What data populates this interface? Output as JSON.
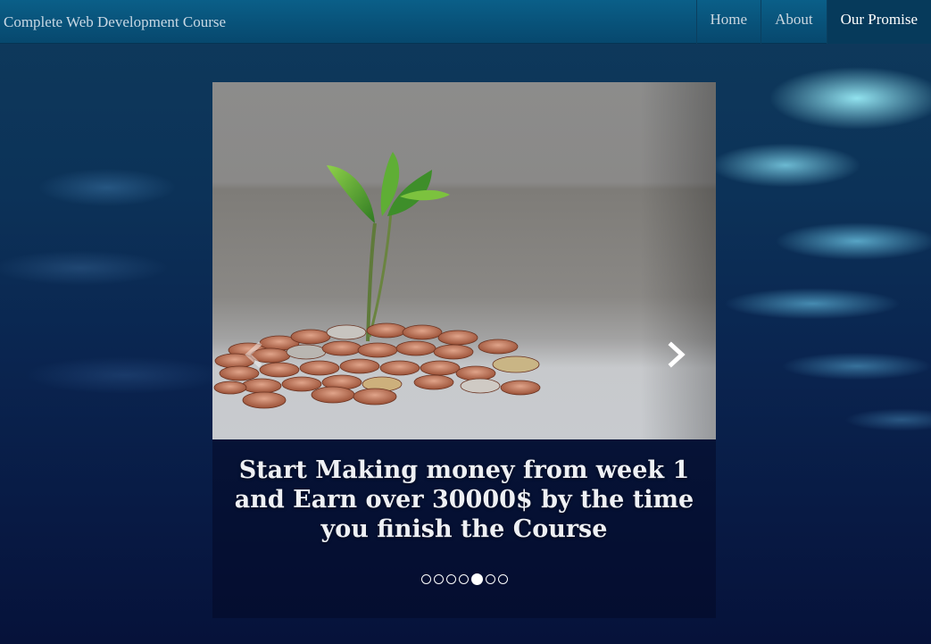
{
  "navbar": {
    "brand": "Complete Web Development Course",
    "links": [
      {
        "label": "Home",
        "active": false
      },
      {
        "label": "About",
        "active": false
      },
      {
        "label": "Our Promise",
        "active": true
      }
    ]
  },
  "carousel": {
    "caption": "Start Making money from week 1 and Earn over 30000$ by the time you finish the Course",
    "image_subject": "seedling growing from a pile of coins",
    "prev_icon": "chevron-left-icon",
    "next_icon": "chevron-right-icon",
    "slide_count": 7,
    "active_slide": 5
  },
  "colors": {
    "navbar": "#07486e",
    "active_link_bg": "#063a5b",
    "background_water": "#0a2550"
  }
}
